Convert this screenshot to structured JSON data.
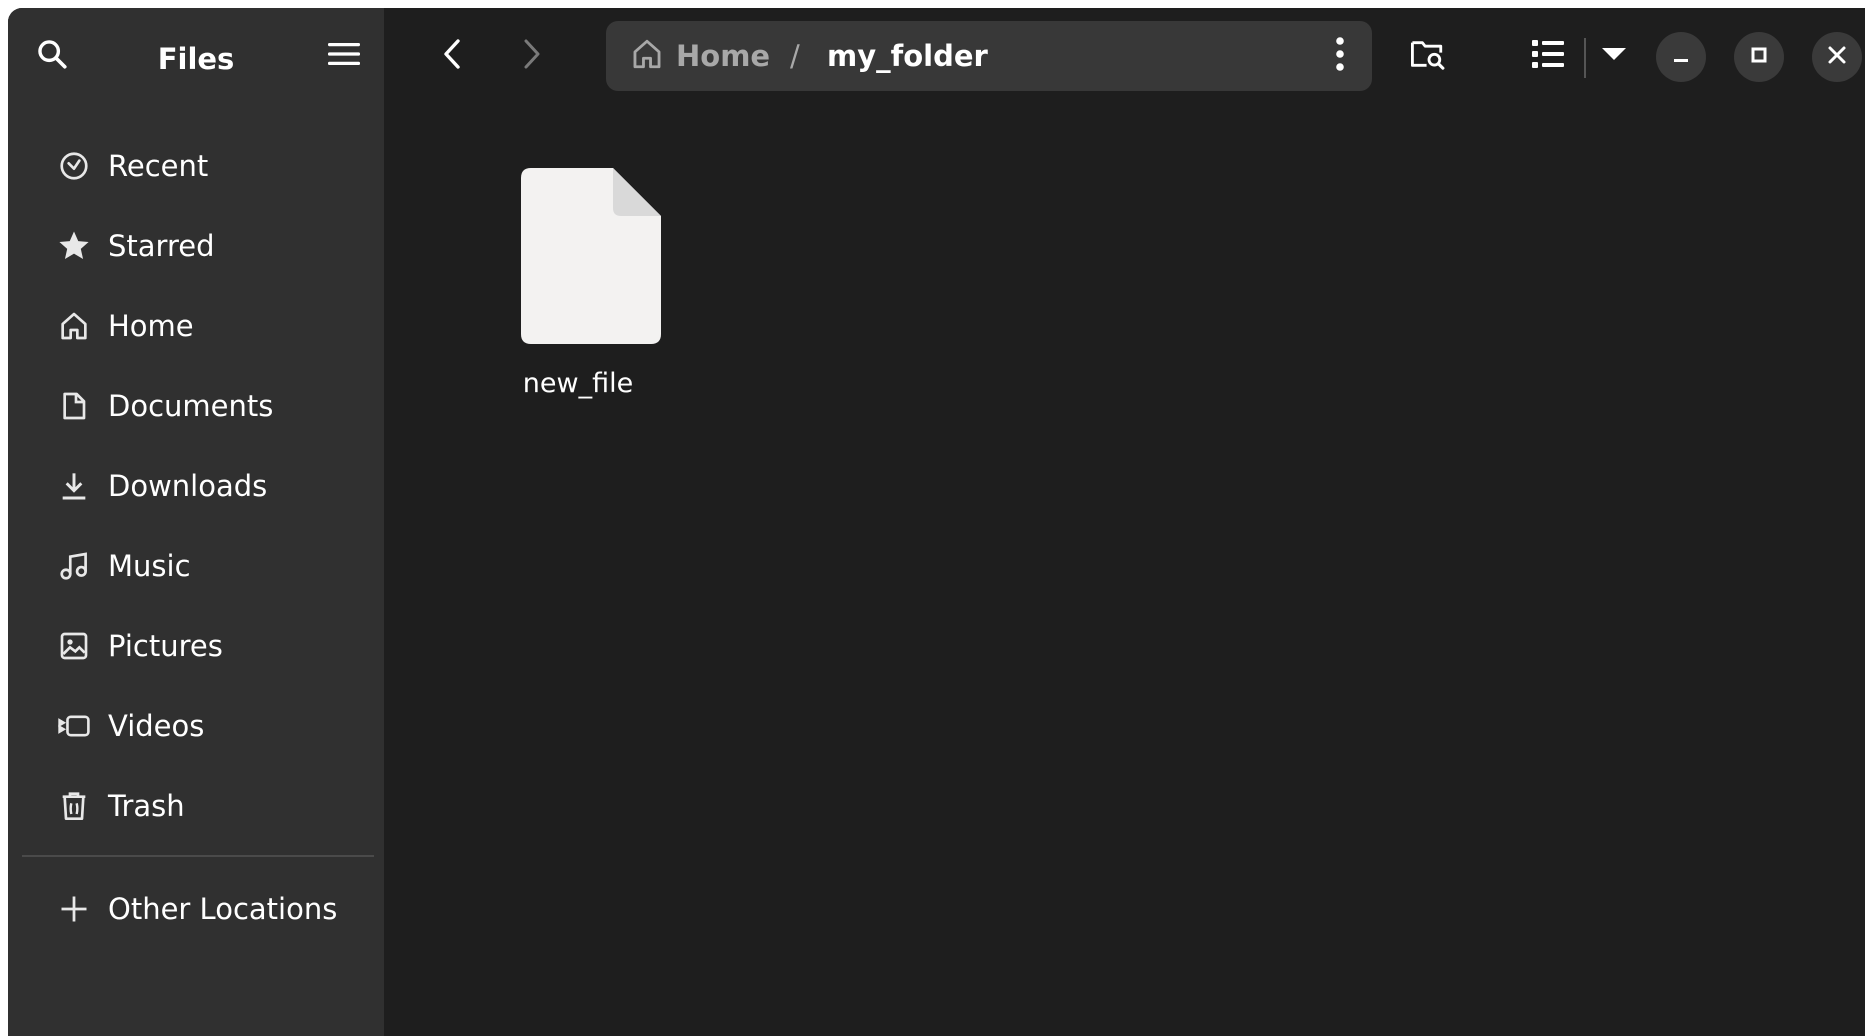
{
  "app": {
    "title": "Files"
  },
  "sidebar": {
    "items": [
      {
        "label": "Recent",
        "icon": "clock-icon"
      },
      {
        "label": "Starred",
        "icon": "star-icon"
      },
      {
        "label": "Home",
        "icon": "home-icon"
      },
      {
        "label": "Documents",
        "icon": "document-icon"
      },
      {
        "label": "Downloads",
        "icon": "download-icon"
      },
      {
        "label": "Music",
        "icon": "music-icon"
      },
      {
        "label": "Pictures",
        "icon": "picture-icon"
      },
      {
        "label": "Videos",
        "icon": "video-icon"
      },
      {
        "label": "Trash",
        "icon": "trash-icon"
      }
    ],
    "other_locations": {
      "label": "Other Locations",
      "icon": "plus-icon"
    }
  },
  "pathbar": {
    "home_label": "Home",
    "separator": "/",
    "current": "my_folder"
  },
  "files": [
    {
      "name": "new_file",
      "icon": "file-icon"
    }
  ],
  "colors": {
    "window_bg": "#1e1e1e",
    "sidebar_bg": "#303030",
    "pathbar_bg": "#383838",
    "file_icon": "#f3f2f1",
    "file_icon_fold": "#d9d9d9"
  }
}
